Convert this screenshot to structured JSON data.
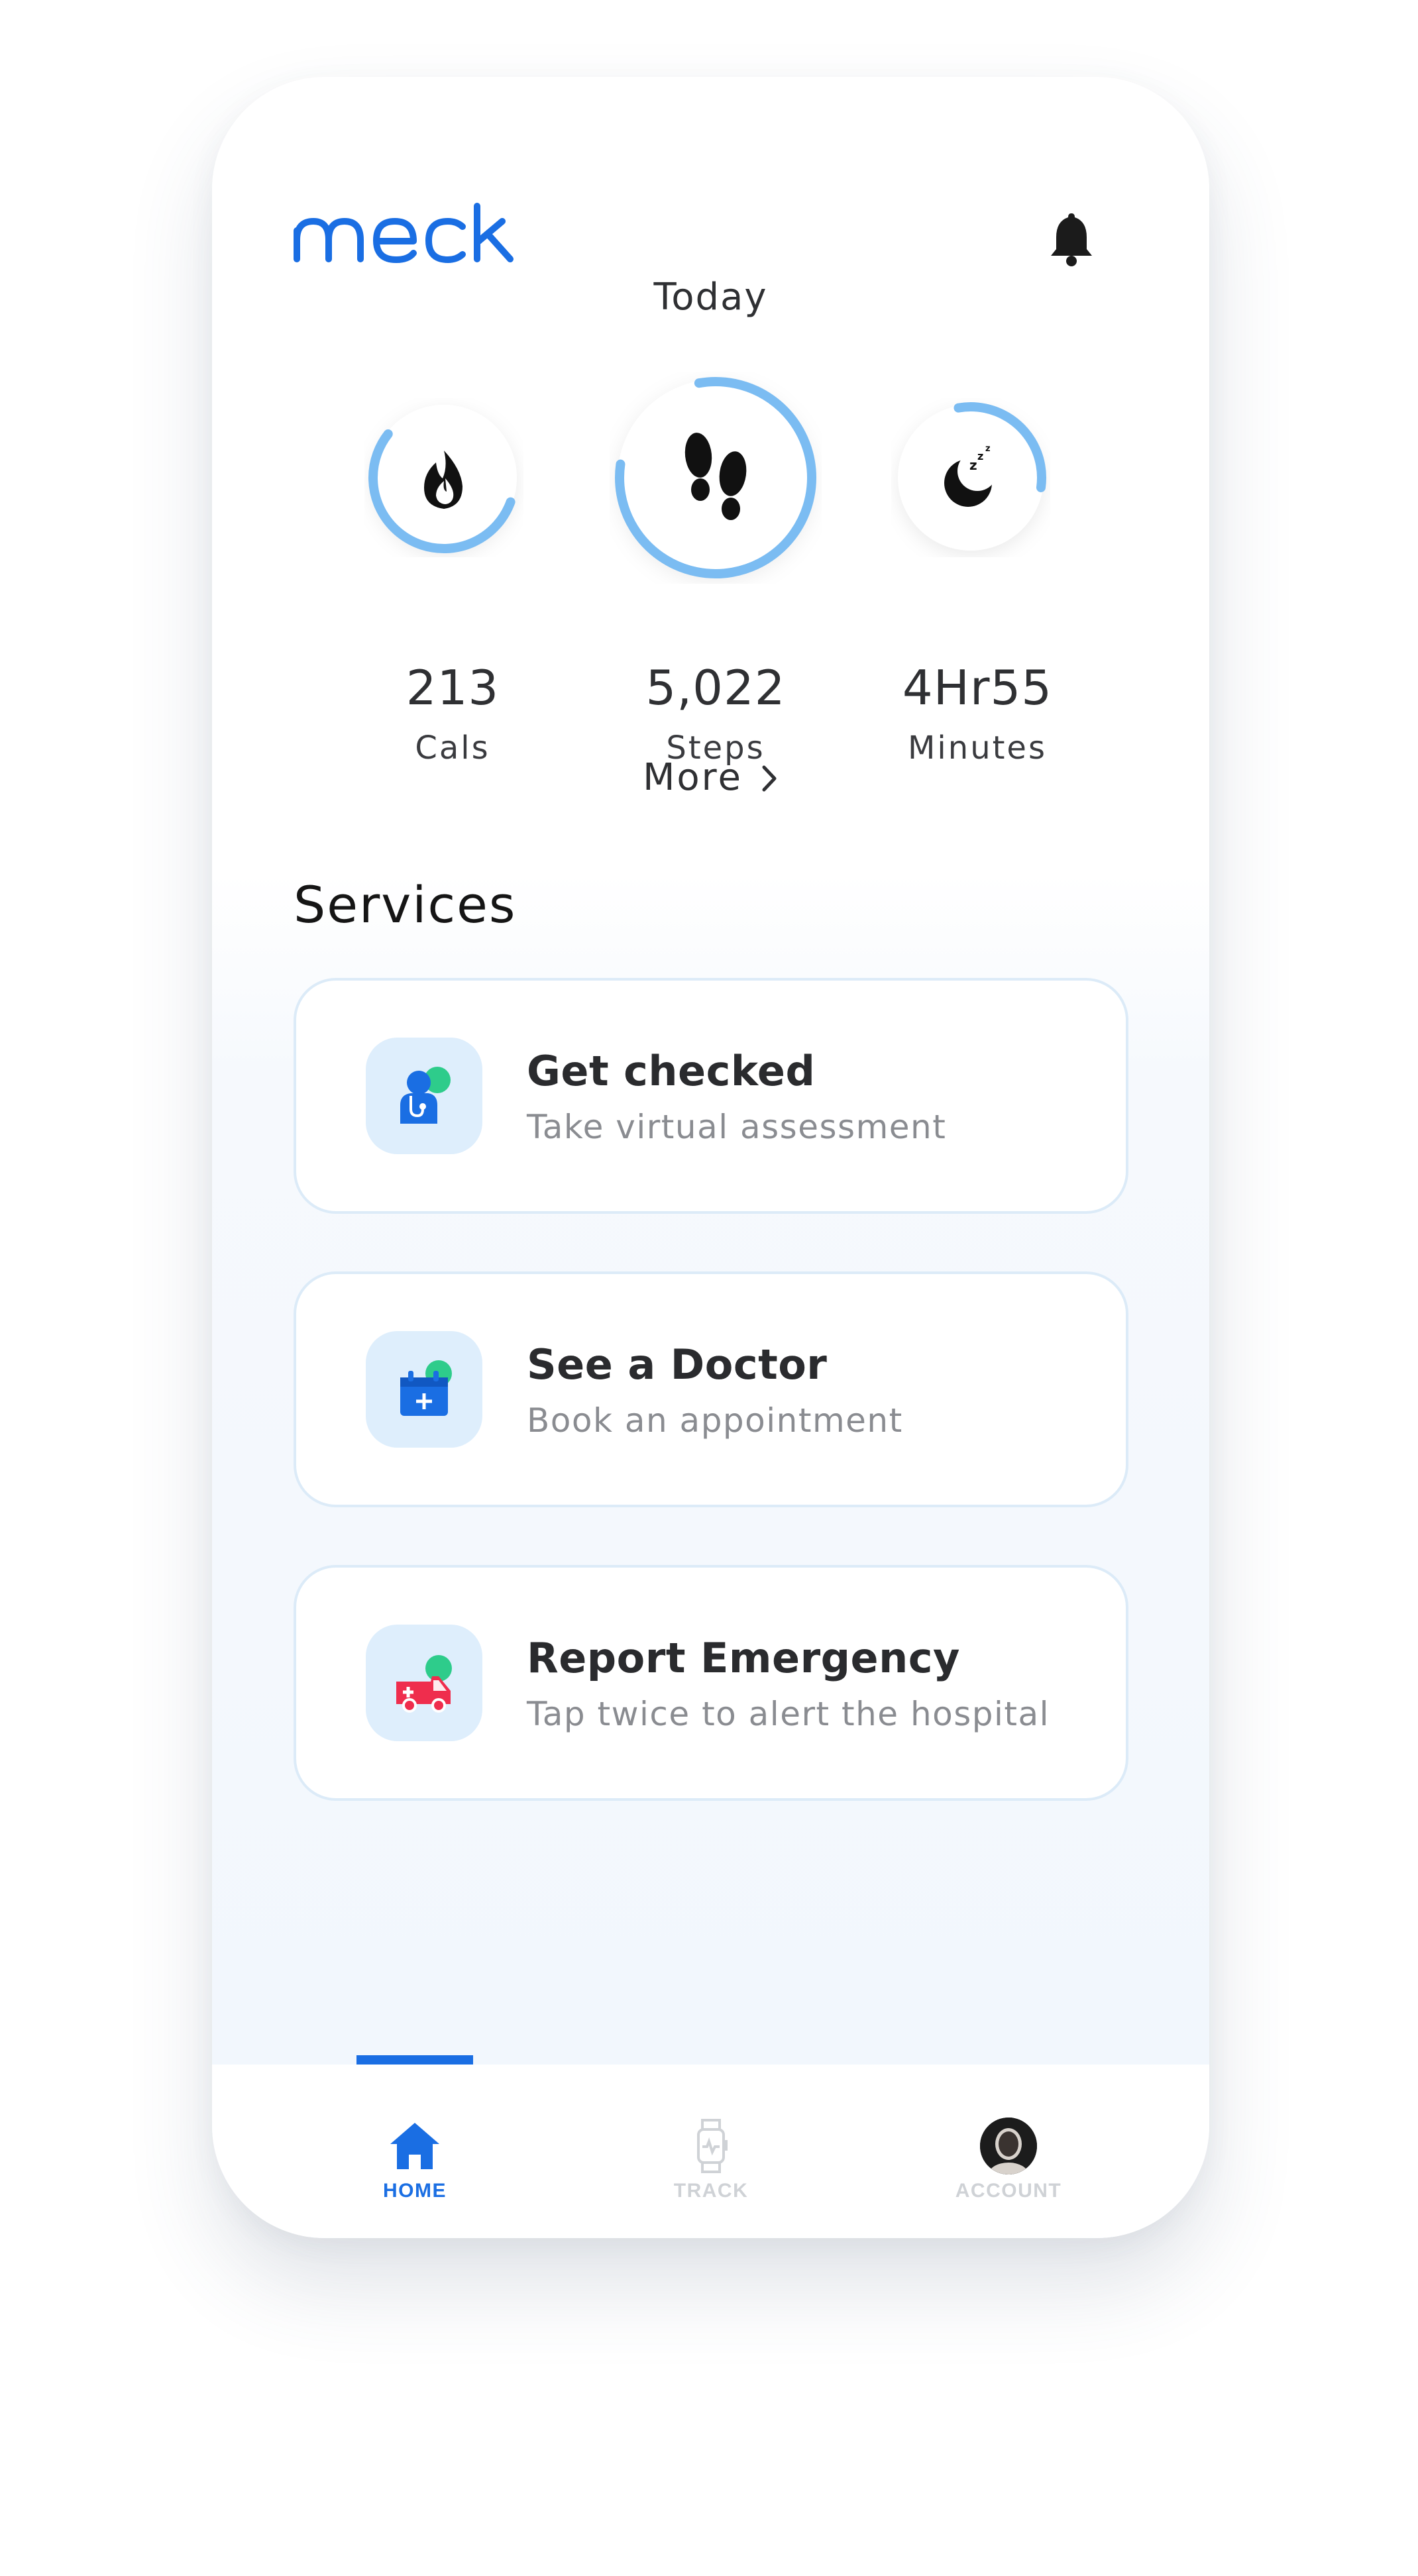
{
  "app": {
    "logo_text": "meck",
    "brand_color": "#1a6ee3",
    "ring_color": "#7bbcf2"
  },
  "header": {
    "notification_icon": "bell-icon"
  },
  "today": {
    "title": "Today",
    "stats": [
      {
        "id": "calories",
        "icon": "flame-icon",
        "value": "213",
        "label": "Cals",
        "progress": 0.55
      },
      {
        "id": "steps",
        "icon": "footprints-icon",
        "value": "5,022",
        "label": "Steps",
        "progress": 0.8
      },
      {
        "id": "sleep",
        "icon": "moon-sleep-icon",
        "value": "4Hr55",
        "label": "Minutes",
        "progress": 0.3
      }
    ],
    "more_label": "More"
  },
  "services": {
    "title": "Services",
    "items": [
      {
        "icon": "doctor-icon",
        "title": "Get checked",
        "subtitle": "Take virtual assessment"
      },
      {
        "icon": "medical-calendar-icon",
        "title": "See a Doctor",
        "subtitle": "Book an appointment"
      },
      {
        "icon": "ambulance-icon",
        "title": "Report Emergency",
        "subtitle": "Tap twice to alert the hospital"
      }
    ]
  },
  "nav": {
    "items": [
      {
        "icon": "home-icon",
        "label": "HOME",
        "active": true,
        "color": "#1a6ee3"
      },
      {
        "icon": "smartwatch-icon",
        "label": "TRACK",
        "active": false,
        "color": "#cfd2d6"
      },
      {
        "icon": "avatar",
        "label": "ACCOUNT",
        "active": false,
        "color": "#cfd2d6"
      }
    ]
  }
}
